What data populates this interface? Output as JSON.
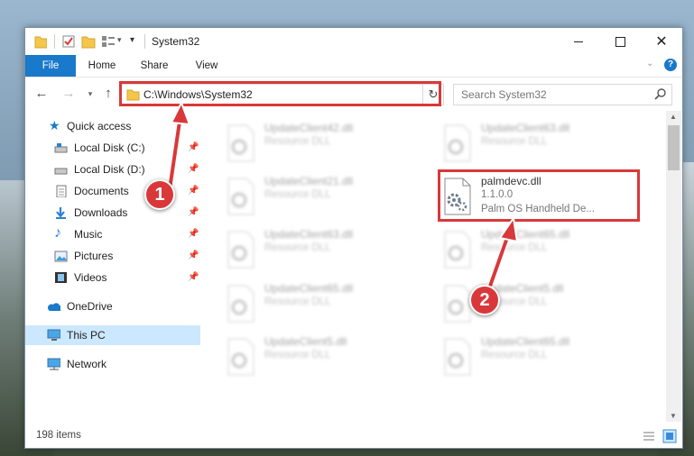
{
  "window": {
    "title": "System32"
  },
  "ribbon": {
    "tabs": [
      {
        "label": "File"
      },
      {
        "label": "Home"
      },
      {
        "label": "Share"
      },
      {
        "label": "View"
      }
    ]
  },
  "address": {
    "path": "C:\\Windows\\System32"
  },
  "search": {
    "placeholder": "Search System32"
  },
  "nav": {
    "quick_access": "Quick access",
    "items": [
      {
        "label": "Local Disk (C:)",
        "icon": "drive-icon"
      },
      {
        "label": "Local Disk (D:)",
        "icon": "drive-icon"
      },
      {
        "label": "Documents",
        "icon": "documents-icon"
      },
      {
        "label": "Downloads",
        "icon": "downloads-icon"
      },
      {
        "label": "Music",
        "icon": "music-icon"
      },
      {
        "label": "Pictures",
        "icon": "pictures-icon"
      },
      {
        "label": "Videos",
        "icon": "videos-icon"
      }
    ],
    "onedrive": "OneDrive",
    "this_pc": "This PC",
    "network": "Network"
  },
  "files": [
    {
      "name": "UpdateClient42.dll",
      "desc": "Resource DLL"
    },
    {
      "name": "UpdateClient63.dll",
      "desc": "Resource DLL"
    },
    {
      "name": "UpdateClient21.dll",
      "desc": "Resource DLL"
    },
    {
      "name": "palmdevc.dll",
      "version": "1.1.0.0",
      "desc": "Palm OS Handheld De..."
    },
    {
      "name": "UpdateClient63.dll",
      "desc": "Resource DLL"
    },
    {
      "name": "UpdateClient65.dll",
      "desc": "Resource DLL"
    },
    {
      "name": "UpdateClient65.dll",
      "desc": "Resource DLL"
    },
    {
      "name": "UpdateClient5.dll",
      "desc": "Resource DLL"
    },
    {
      "name": "UpdateClient5.dll",
      "desc": "Resource DLL"
    },
    {
      "name": "UpdateClient65.dll",
      "desc": "Resource DLL"
    }
  ],
  "status": {
    "count": "198 items"
  },
  "annotations": {
    "step1": "1",
    "step2": "2",
    "color": "#d9383a"
  }
}
